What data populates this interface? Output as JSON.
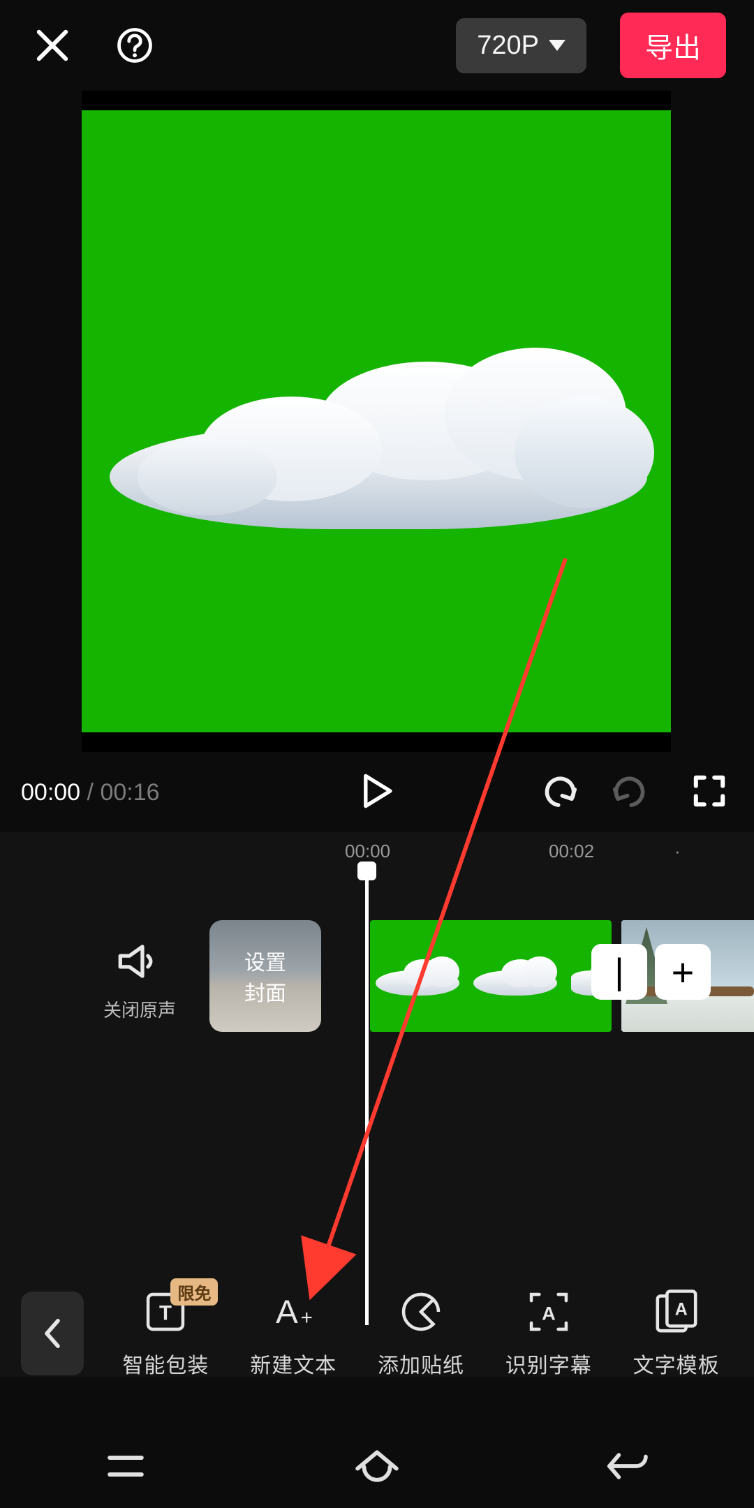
{
  "header": {
    "resolution": "720P",
    "export_label": "导出"
  },
  "transport": {
    "current_time": "00:00",
    "duration": "00:16"
  },
  "timeline": {
    "labels": [
      "00:00",
      "00:02"
    ],
    "mute_label": "关闭原声",
    "cover_line1": "设置",
    "cover_line2": "封面",
    "transition_glyph": "|",
    "add_glyph": "+"
  },
  "toolbar": {
    "badge": "限免",
    "items": [
      {
        "label": "智能包装"
      },
      {
        "label": "新建文本"
      },
      {
        "label": "添加贴纸"
      },
      {
        "label": "识别字幕"
      },
      {
        "label": "文字模板"
      }
    ]
  },
  "colors": {
    "green": "#14b400",
    "accent": "#ff2a55"
  }
}
